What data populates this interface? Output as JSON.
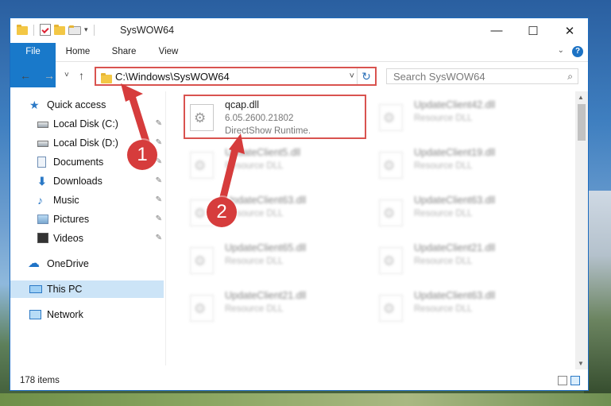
{
  "window": {
    "title": "SysWOW64"
  },
  "ribbon": {
    "tabs": [
      "File",
      "Home",
      "Share",
      "View"
    ],
    "help": "?"
  },
  "controls": {
    "minimize": "—",
    "maximize": "☐",
    "close": "✕"
  },
  "nav": {
    "back": "←",
    "forward": "→",
    "recent": "˅",
    "up": "↑",
    "address": "C:\\Windows\\SysWOW64",
    "dropdown": "˅",
    "refresh": "↻",
    "search_placeholder": "Search SysWOW64",
    "search_icon": "⌕"
  },
  "sidebar": {
    "items": [
      {
        "label": "Quick access",
        "icon": "star-icon",
        "pin": ""
      },
      {
        "label": "Local Disk (C:)",
        "icon": "disk-icon",
        "pin": "✎"
      },
      {
        "label": "Local Disk (D:)",
        "icon": "disk-icon",
        "pin": "✎"
      },
      {
        "label": "Documents",
        "icon": "document-icon",
        "pin": "✎"
      },
      {
        "label": "Downloads",
        "icon": "download-icon",
        "pin": "✎"
      },
      {
        "label": "Music",
        "icon": "music-icon",
        "pin": "✎"
      },
      {
        "label": "Pictures",
        "icon": "pictures-icon",
        "pin": "✎"
      },
      {
        "label": "Videos",
        "icon": "videos-icon",
        "pin": "✎"
      },
      {
        "label": "OneDrive",
        "icon": "cloud-icon",
        "pin": ""
      },
      {
        "label": "This PC",
        "icon": "computer-icon",
        "pin": ""
      },
      {
        "label": "Network",
        "icon": "network-icon",
        "pin": ""
      }
    ]
  },
  "files": [
    {
      "name": "qcap.dll",
      "line1": "6.05.2600.21802",
      "line2": "DirectShow Runtime."
    },
    {
      "name": "UpdateClient42.dll",
      "line1": "Resource DLL"
    },
    {
      "name": "UpdateClient5.dll",
      "line1": "Resource DLL"
    },
    {
      "name": "UpdateClient19.dll",
      "line1": "Resource DLL"
    },
    {
      "name": "UpdateClient63.dll",
      "line1": "Resource DLL"
    },
    {
      "name": "UpdateClient63.dll",
      "line1": "Resource DLL"
    },
    {
      "name": "UpdateClient65.dll",
      "line1": "Resource DLL"
    },
    {
      "name": "UpdateClient21.dll",
      "line1": "Resource DLL"
    },
    {
      "name": "UpdateClient21.dll",
      "line1": "Resource DLL"
    },
    {
      "name": "UpdateClient63.dll",
      "line1": "Resource DLL"
    }
  ],
  "status": {
    "count": "178 items"
  },
  "annotations": {
    "step1": "1",
    "step2": "2"
  },
  "colors": {
    "accent": "#1979ca",
    "highlight": "#d9534f",
    "selected": "#cce4f7"
  }
}
